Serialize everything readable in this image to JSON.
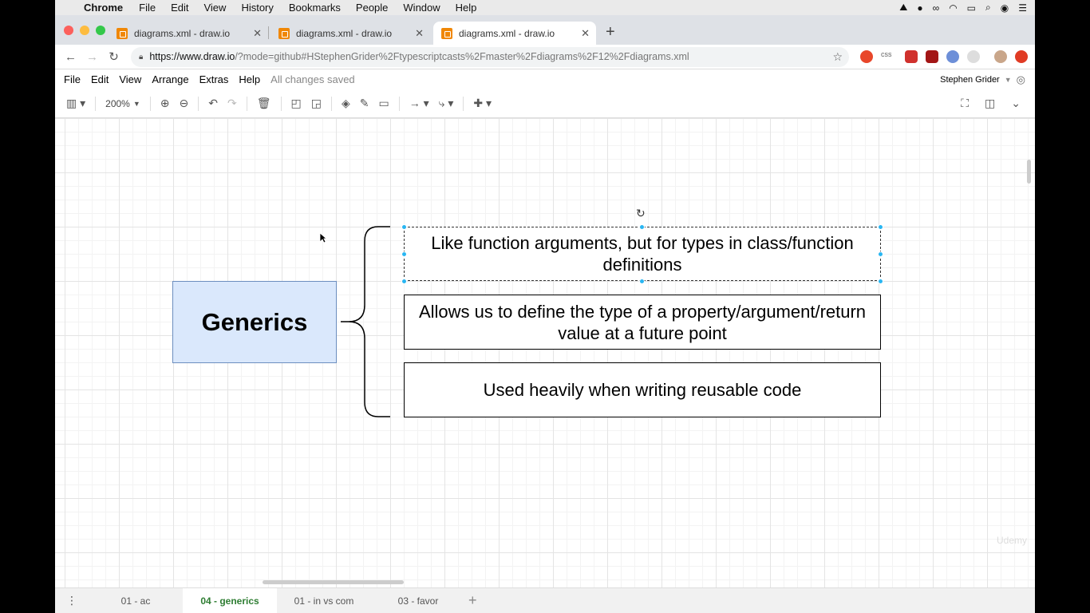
{
  "mac_menu": {
    "app": "Chrome",
    "items": [
      "File",
      "Edit",
      "View",
      "History",
      "Bookmarks",
      "People",
      "Window",
      "Help"
    ]
  },
  "tabs": [
    {
      "title": "diagrams.xml - draw.io"
    },
    {
      "title": "diagrams.xml - draw.io"
    },
    {
      "title": "diagrams.xml - draw.io"
    }
  ],
  "address": {
    "url_host": "https://www.draw.io",
    "url_rest": "/?mode=github#HStephenGrider%2Ftypescriptcasts%2Fmaster%2Fdiagrams%2F12%2Fdiagrams.xml"
  },
  "drawio_menu": {
    "items": [
      "File",
      "Edit",
      "View",
      "Arrange",
      "Extras",
      "Help"
    ],
    "status": "All changes saved",
    "user": "Stephen Grider"
  },
  "toolbar": {
    "zoom": "200%"
  },
  "diagram": {
    "main": "Generics",
    "notes": [
      "Like function arguments, but for types in class/function definitions",
      "Allows us to define the type of a property/argument/return value at a future point",
      "Used heavily when writing reusable code"
    ]
  },
  "pages": [
    "01 - ac",
    "04 - generics",
    "01 - in vs com",
    "03 - favor"
  ],
  "watermark": "Udemy",
  "colors": {
    "main_fill": "#dae8fc",
    "main_stroke": "#6c8ebf",
    "handle": "#29b6f2",
    "active_page": "#2e7d32",
    "drawio_orange": "#f08705"
  }
}
